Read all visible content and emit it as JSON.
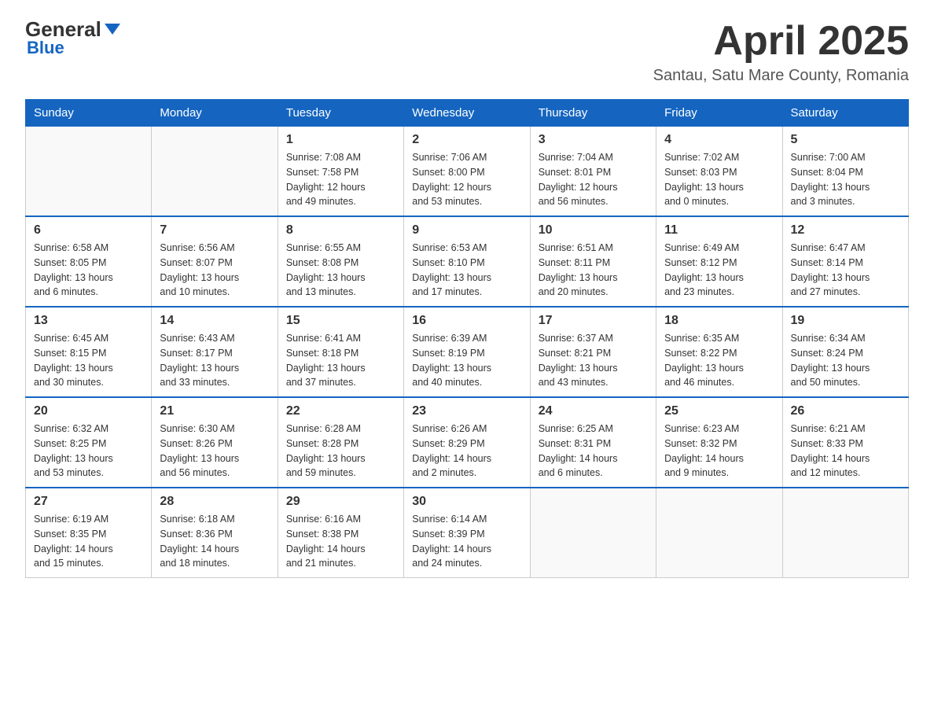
{
  "header": {
    "logo_general": "General",
    "logo_blue": "Blue",
    "month_title": "April 2025",
    "location": "Santau, Satu Mare County, Romania"
  },
  "calendar": {
    "days": [
      "Sunday",
      "Monday",
      "Tuesday",
      "Wednesday",
      "Thursday",
      "Friday",
      "Saturday"
    ],
    "weeks": [
      [
        {
          "day": "",
          "info": ""
        },
        {
          "day": "",
          "info": ""
        },
        {
          "day": "1",
          "info": "Sunrise: 7:08 AM\nSunset: 7:58 PM\nDaylight: 12 hours\nand 49 minutes."
        },
        {
          "day": "2",
          "info": "Sunrise: 7:06 AM\nSunset: 8:00 PM\nDaylight: 12 hours\nand 53 minutes."
        },
        {
          "day": "3",
          "info": "Sunrise: 7:04 AM\nSunset: 8:01 PM\nDaylight: 12 hours\nand 56 minutes."
        },
        {
          "day": "4",
          "info": "Sunrise: 7:02 AM\nSunset: 8:03 PM\nDaylight: 13 hours\nand 0 minutes."
        },
        {
          "day": "5",
          "info": "Sunrise: 7:00 AM\nSunset: 8:04 PM\nDaylight: 13 hours\nand 3 minutes."
        }
      ],
      [
        {
          "day": "6",
          "info": "Sunrise: 6:58 AM\nSunset: 8:05 PM\nDaylight: 13 hours\nand 6 minutes."
        },
        {
          "day": "7",
          "info": "Sunrise: 6:56 AM\nSunset: 8:07 PM\nDaylight: 13 hours\nand 10 minutes."
        },
        {
          "day": "8",
          "info": "Sunrise: 6:55 AM\nSunset: 8:08 PM\nDaylight: 13 hours\nand 13 minutes."
        },
        {
          "day": "9",
          "info": "Sunrise: 6:53 AM\nSunset: 8:10 PM\nDaylight: 13 hours\nand 17 minutes."
        },
        {
          "day": "10",
          "info": "Sunrise: 6:51 AM\nSunset: 8:11 PM\nDaylight: 13 hours\nand 20 minutes."
        },
        {
          "day": "11",
          "info": "Sunrise: 6:49 AM\nSunset: 8:12 PM\nDaylight: 13 hours\nand 23 minutes."
        },
        {
          "day": "12",
          "info": "Sunrise: 6:47 AM\nSunset: 8:14 PM\nDaylight: 13 hours\nand 27 minutes."
        }
      ],
      [
        {
          "day": "13",
          "info": "Sunrise: 6:45 AM\nSunset: 8:15 PM\nDaylight: 13 hours\nand 30 minutes."
        },
        {
          "day": "14",
          "info": "Sunrise: 6:43 AM\nSunset: 8:17 PM\nDaylight: 13 hours\nand 33 minutes."
        },
        {
          "day": "15",
          "info": "Sunrise: 6:41 AM\nSunset: 8:18 PM\nDaylight: 13 hours\nand 37 minutes."
        },
        {
          "day": "16",
          "info": "Sunrise: 6:39 AM\nSunset: 8:19 PM\nDaylight: 13 hours\nand 40 minutes."
        },
        {
          "day": "17",
          "info": "Sunrise: 6:37 AM\nSunset: 8:21 PM\nDaylight: 13 hours\nand 43 minutes."
        },
        {
          "day": "18",
          "info": "Sunrise: 6:35 AM\nSunset: 8:22 PM\nDaylight: 13 hours\nand 46 minutes."
        },
        {
          "day": "19",
          "info": "Sunrise: 6:34 AM\nSunset: 8:24 PM\nDaylight: 13 hours\nand 50 minutes."
        }
      ],
      [
        {
          "day": "20",
          "info": "Sunrise: 6:32 AM\nSunset: 8:25 PM\nDaylight: 13 hours\nand 53 minutes."
        },
        {
          "day": "21",
          "info": "Sunrise: 6:30 AM\nSunset: 8:26 PM\nDaylight: 13 hours\nand 56 minutes."
        },
        {
          "day": "22",
          "info": "Sunrise: 6:28 AM\nSunset: 8:28 PM\nDaylight: 13 hours\nand 59 minutes."
        },
        {
          "day": "23",
          "info": "Sunrise: 6:26 AM\nSunset: 8:29 PM\nDaylight: 14 hours\nand 2 minutes."
        },
        {
          "day": "24",
          "info": "Sunrise: 6:25 AM\nSunset: 8:31 PM\nDaylight: 14 hours\nand 6 minutes."
        },
        {
          "day": "25",
          "info": "Sunrise: 6:23 AM\nSunset: 8:32 PM\nDaylight: 14 hours\nand 9 minutes."
        },
        {
          "day": "26",
          "info": "Sunrise: 6:21 AM\nSunset: 8:33 PM\nDaylight: 14 hours\nand 12 minutes."
        }
      ],
      [
        {
          "day": "27",
          "info": "Sunrise: 6:19 AM\nSunset: 8:35 PM\nDaylight: 14 hours\nand 15 minutes."
        },
        {
          "day": "28",
          "info": "Sunrise: 6:18 AM\nSunset: 8:36 PM\nDaylight: 14 hours\nand 18 minutes."
        },
        {
          "day": "29",
          "info": "Sunrise: 6:16 AM\nSunset: 8:38 PM\nDaylight: 14 hours\nand 21 minutes."
        },
        {
          "day": "30",
          "info": "Sunrise: 6:14 AM\nSunset: 8:39 PM\nDaylight: 14 hours\nand 24 minutes."
        },
        {
          "day": "",
          "info": ""
        },
        {
          "day": "",
          "info": ""
        },
        {
          "day": "",
          "info": ""
        }
      ]
    ]
  }
}
